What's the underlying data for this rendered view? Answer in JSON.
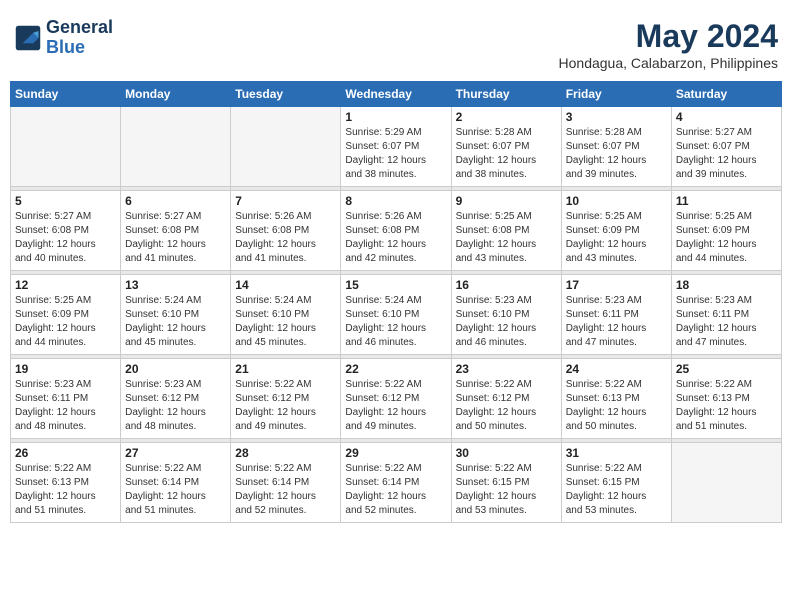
{
  "header": {
    "logo_line1": "General",
    "logo_line2": "Blue",
    "month_title": "May 2024",
    "location": "Hondagua, Calabarzon, Philippines"
  },
  "weekdays": [
    "Sunday",
    "Monday",
    "Tuesday",
    "Wednesday",
    "Thursday",
    "Friday",
    "Saturday"
  ],
  "weeks": [
    [
      {
        "day": "",
        "info": ""
      },
      {
        "day": "",
        "info": ""
      },
      {
        "day": "",
        "info": ""
      },
      {
        "day": "1",
        "info": "Sunrise: 5:29 AM\nSunset: 6:07 PM\nDaylight: 12 hours\nand 38 minutes."
      },
      {
        "day": "2",
        "info": "Sunrise: 5:28 AM\nSunset: 6:07 PM\nDaylight: 12 hours\nand 38 minutes."
      },
      {
        "day": "3",
        "info": "Sunrise: 5:28 AM\nSunset: 6:07 PM\nDaylight: 12 hours\nand 39 minutes."
      },
      {
        "day": "4",
        "info": "Sunrise: 5:27 AM\nSunset: 6:07 PM\nDaylight: 12 hours\nand 39 minutes."
      }
    ],
    [
      {
        "day": "5",
        "info": "Sunrise: 5:27 AM\nSunset: 6:08 PM\nDaylight: 12 hours\nand 40 minutes."
      },
      {
        "day": "6",
        "info": "Sunrise: 5:27 AM\nSunset: 6:08 PM\nDaylight: 12 hours\nand 41 minutes."
      },
      {
        "day": "7",
        "info": "Sunrise: 5:26 AM\nSunset: 6:08 PM\nDaylight: 12 hours\nand 41 minutes."
      },
      {
        "day": "8",
        "info": "Sunrise: 5:26 AM\nSunset: 6:08 PM\nDaylight: 12 hours\nand 42 minutes."
      },
      {
        "day": "9",
        "info": "Sunrise: 5:25 AM\nSunset: 6:08 PM\nDaylight: 12 hours\nand 43 minutes."
      },
      {
        "day": "10",
        "info": "Sunrise: 5:25 AM\nSunset: 6:09 PM\nDaylight: 12 hours\nand 43 minutes."
      },
      {
        "day": "11",
        "info": "Sunrise: 5:25 AM\nSunset: 6:09 PM\nDaylight: 12 hours\nand 44 minutes."
      }
    ],
    [
      {
        "day": "12",
        "info": "Sunrise: 5:25 AM\nSunset: 6:09 PM\nDaylight: 12 hours\nand 44 minutes."
      },
      {
        "day": "13",
        "info": "Sunrise: 5:24 AM\nSunset: 6:10 PM\nDaylight: 12 hours\nand 45 minutes."
      },
      {
        "day": "14",
        "info": "Sunrise: 5:24 AM\nSunset: 6:10 PM\nDaylight: 12 hours\nand 45 minutes."
      },
      {
        "day": "15",
        "info": "Sunrise: 5:24 AM\nSunset: 6:10 PM\nDaylight: 12 hours\nand 46 minutes."
      },
      {
        "day": "16",
        "info": "Sunrise: 5:23 AM\nSunset: 6:10 PM\nDaylight: 12 hours\nand 46 minutes."
      },
      {
        "day": "17",
        "info": "Sunrise: 5:23 AM\nSunset: 6:11 PM\nDaylight: 12 hours\nand 47 minutes."
      },
      {
        "day": "18",
        "info": "Sunrise: 5:23 AM\nSunset: 6:11 PM\nDaylight: 12 hours\nand 47 minutes."
      }
    ],
    [
      {
        "day": "19",
        "info": "Sunrise: 5:23 AM\nSunset: 6:11 PM\nDaylight: 12 hours\nand 48 minutes."
      },
      {
        "day": "20",
        "info": "Sunrise: 5:23 AM\nSunset: 6:12 PM\nDaylight: 12 hours\nand 48 minutes."
      },
      {
        "day": "21",
        "info": "Sunrise: 5:22 AM\nSunset: 6:12 PM\nDaylight: 12 hours\nand 49 minutes."
      },
      {
        "day": "22",
        "info": "Sunrise: 5:22 AM\nSunset: 6:12 PM\nDaylight: 12 hours\nand 49 minutes."
      },
      {
        "day": "23",
        "info": "Sunrise: 5:22 AM\nSunset: 6:12 PM\nDaylight: 12 hours\nand 50 minutes."
      },
      {
        "day": "24",
        "info": "Sunrise: 5:22 AM\nSunset: 6:13 PM\nDaylight: 12 hours\nand 50 minutes."
      },
      {
        "day": "25",
        "info": "Sunrise: 5:22 AM\nSunset: 6:13 PM\nDaylight: 12 hours\nand 51 minutes."
      }
    ],
    [
      {
        "day": "26",
        "info": "Sunrise: 5:22 AM\nSunset: 6:13 PM\nDaylight: 12 hours\nand 51 minutes."
      },
      {
        "day": "27",
        "info": "Sunrise: 5:22 AM\nSunset: 6:14 PM\nDaylight: 12 hours\nand 51 minutes."
      },
      {
        "day": "28",
        "info": "Sunrise: 5:22 AM\nSunset: 6:14 PM\nDaylight: 12 hours\nand 52 minutes."
      },
      {
        "day": "29",
        "info": "Sunrise: 5:22 AM\nSunset: 6:14 PM\nDaylight: 12 hours\nand 52 minutes."
      },
      {
        "day": "30",
        "info": "Sunrise: 5:22 AM\nSunset: 6:15 PM\nDaylight: 12 hours\nand 53 minutes."
      },
      {
        "day": "31",
        "info": "Sunrise: 5:22 AM\nSunset: 6:15 PM\nDaylight: 12 hours\nand 53 minutes."
      },
      {
        "day": "",
        "info": ""
      }
    ]
  ]
}
